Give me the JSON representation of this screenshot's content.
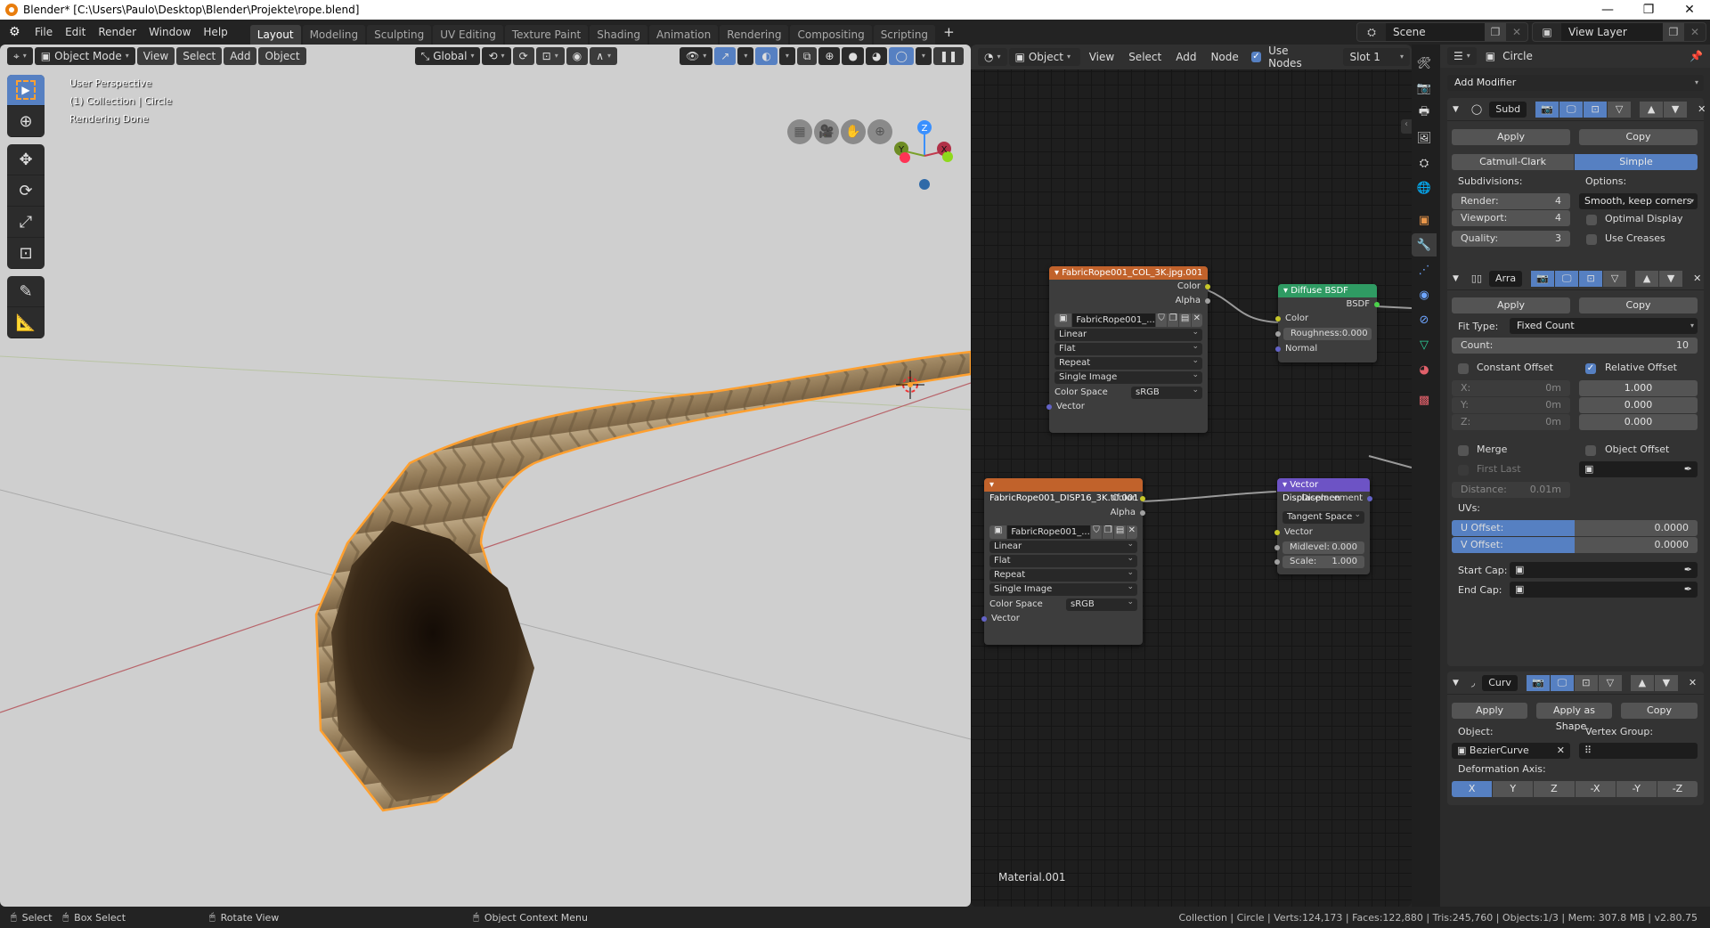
{
  "window": {
    "title": "Blender* [C:\\Users\\Paulo\\Desktop\\Blender\\Projekte\\rope.blend]",
    "controls": [
      "—",
      "❐",
      "✕"
    ]
  },
  "menu": [
    "File",
    "Edit",
    "Render",
    "Window",
    "Help"
  ],
  "workspaces": [
    {
      "label": "Layout",
      "active": true
    },
    {
      "label": "Modeling"
    },
    {
      "label": "Sculpting"
    },
    {
      "label": "UV Editing"
    },
    {
      "label": "Texture Paint"
    },
    {
      "label": "Shading"
    },
    {
      "label": "Animation"
    },
    {
      "label": "Rendering"
    },
    {
      "label": "Compositing"
    },
    {
      "label": "Scripting"
    }
  ],
  "add_workspace": "+",
  "scene": {
    "name": "Scene",
    "view_layer": "View Layer"
  },
  "viewport": {
    "mode": "Object Mode",
    "menus": [
      "View",
      "Select",
      "Add",
      "Object"
    ],
    "transform_orientation": "Global",
    "info": [
      "User Perspective",
      "(1) Collection | Circle",
      "Rendering Done"
    ],
    "gizmo_axes": [
      "X",
      "Y",
      "Z"
    ]
  },
  "node_editor": {
    "object_type": "Object",
    "menus": [
      "View",
      "Select",
      "Add",
      "Node"
    ],
    "use_nodes_label": "Use Nodes",
    "use_nodes": true,
    "slot": "Slot 1",
    "material_name": "Material.001",
    "nodes": {
      "image_col": {
        "title": "FabricRope001_COL_3K.jpg.001",
        "outputs": [
          "Color",
          "Alpha"
        ],
        "image": "FabricRope001_...",
        "interpolation": "Linear",
        "projection": "Flat",
        "extension": "Repeat",
        "source": "Single Image",
        "color_space_label": "Color Space",
        "color_space": "sRGB",
        "input": "Vector"
      },
      "image_disp": {
        "title": "FabricRope001_DISP16_3K.tif.001",
        "outputs": [
          "Color",
          "Alpha"
        ],
        "image": "FabricRope001_...",
        "interpolation": "Linear",
        "projection": "Flat",
        "extension": "Repeat",
        "source": "Single Image",
        "color_space_label": "Color Space",
        "color_space": "sRGB",
        "input": "Vector"
      },
      "diffuse": {
        "title": "Diffuse BSDF",
        "output": "BSDF",
        "color_label": "Color",
        "roughness_label": "Roughness:",
        "roughness": "0.000",
        "normal_label": "Normal"
      },
      "vector_disp": {
        "title": "Vector Displacemen",
        "output": "Displacement",
        "space": "Tangent Space",
        "vector_label": "Vector",
        "midlevel_label": "Midlevel:",
        "midlevel": "0.000",
        "scale_label": "Scale:",
        "scale": "1.000"
      }
    }
  },
  "properties": {
    "object_name": "Circle",
    "add_modifier": "Add Modifier",
    "subd": {
      "name": "Subd",
      "apply": "Apply",
      "copy": "Copy",
      "type_options": [
        "Catmull-Clark",
        "Simple"
      ],
      "type_selected": "Simple",
      "subdivisions_label": "Subdivisions:",
      "options_label": "Options:",
      "render_label": "Render:",
      "render": "4",
      "viewport_label": "Viewport:",
      "viewport": "4",
      "quality_label": "Quality:",
      "quality": "3",
      "uv_smooth": "Smooth, keep corners",
      "optimal_display": "Optimal Display",
      "optimal_display_on": false,
      "use_creases": "Use Creases",
      "use_creases_on": false
    },
    "array": {
      "name": "Arra",
      "apply": "Apply",
      "copy": "Copy",
      "fit_type_label": "Fit Type:",
      "fit_type": "Fixed Count",
      "count_label": "Count:",
      "count": "10",
      "constant_offset": "Constant Offset",
      "constant_offset_on": false,
      "relative_offset": "Relative Offset",
      "relative_offset_on": true,
      "const": [
        {
          "label": "X:",
          "value": "0m"
        },
        {
          "label": "Y:",
          "value": "0m"
        },
        {
          "label": "Z:",
          "value": "0m"
        }
      ],
      "rel": [
        "1.000",
        "0.000",
        "0.000"
      ],
      "merge": "Merge",
      "merge_on": false,
      "object_offset": "Object Offset",
      "object_offset_on": false,
      "first_last": "First Last",
      "distance_label": "Distance:",
      "distance": "0.01m",
      "uvs_label": "UVs:",
      "u_offset_label": "U Offset:",
      "u_offset": "0.0000",
      "v_offset_label": "V Offset:",
      "v_offset": "0.0000",
      "start_cap_label": "Start Cap:",
      "end_cap_label": "End Cap:"
    },
    "curve": {
      "name": "Curv",
      "apply": "Apply",
      "apply_shape": "Apply as Shape..",
      "copy": "Copy",
      "object_label": "Object:",
      "object": "BezierCurve",
      "vertex_group_label": "Vertex Group:",
      "deform_axis_label": "Deformation Axis:",
      "axes": [
        "X",
        "Y",
        "Z",
        "-X",
        "-Y",
        "-Z"
      ],
      "axis_selected": "X"
    }
  },
  "status": {
    "hints": [
      {
        "label": "Select"
      },
      {
        "label": "Box Select"
      },
      {
        "label": "Rotate View"
      },
      {
        "label": "Object Context Menu"
      }
    ],
    "stats": "Collection | Circle | Verts:124,173 | Faces:122,880 | Tris:245,760 | Objects:1/3 | Mem: 307.8 MB | v2.80.75"
  },
  "colors": {
    "accent": "#5680c2",
    "selection": "#ffa030",
    "texture_node": "#c1622b",
    "shader_node": "#2f9b63",
    "vector_node": "#6d53c5"
  }
}
